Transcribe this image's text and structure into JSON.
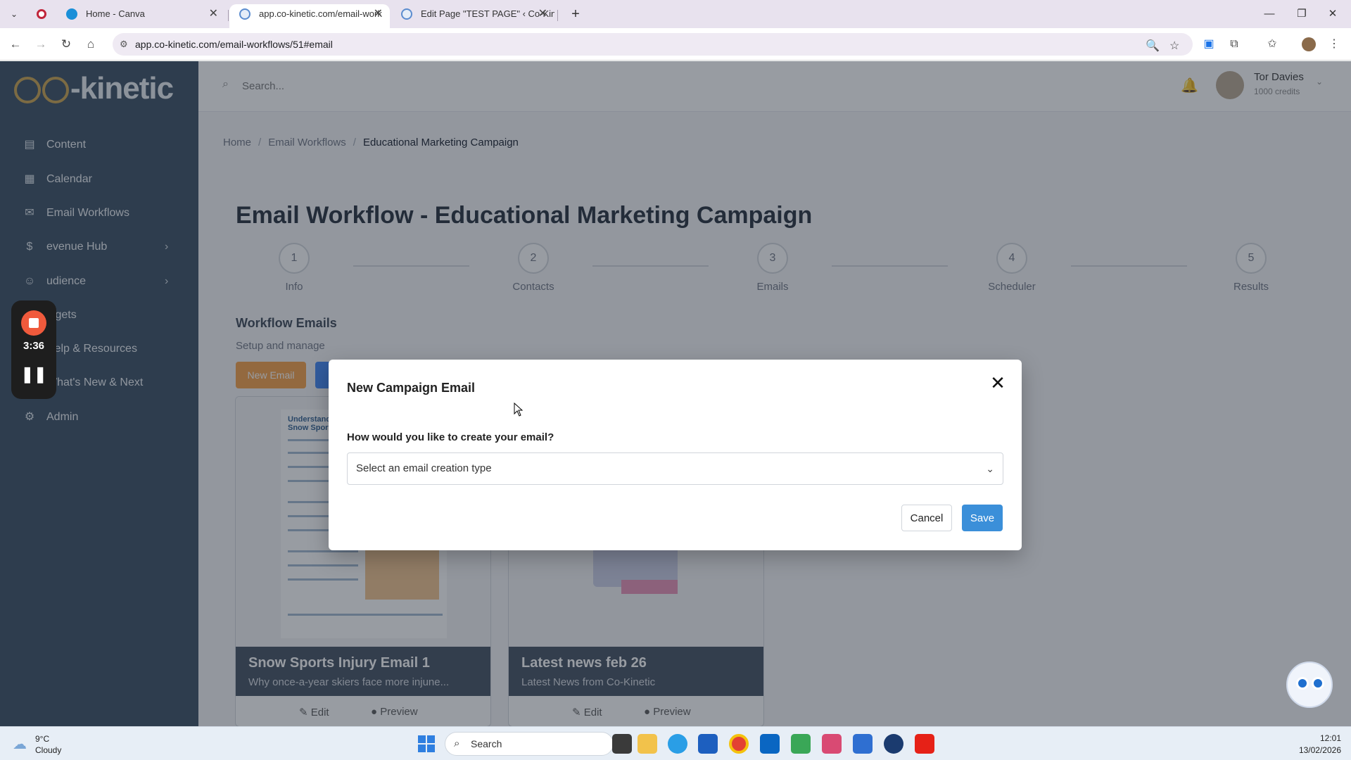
{
  "browser": {
    "tabs": [
      {
        "title": "Home - Canva",
        "active": false
      },
      {
        "title": "app.co-kinetic.com/email-work",
        "active": true
      },
      {
        "title": "Edit Page \"TEST PAGE\" ‹ Co-Kin",
        "active": false
      }
    ],
    "url": "app.co-kinetic.com/email-workflows/51#email"
  },
  "app": {
    "logo_text": "-kinetic",
    "sidebar": {
      "items": [
        {
          "label": "Content",
          "icon": "document-icon"
        },
        {
          "label": "Calendar",
          "icon": "calendar-icon"
        },
        {
          "label": "Email Workflows",
          "icon": "mail-icon"
        },
        {
          "label": "evenue Hub",
          "icon": "revenue-icon"
        },
        {
          "label": "udience",
          "icon": "audience-icon"
        },
        {
          "label": "idgets",
          "icon": "widgets-icon"
        },
        {
          "label": "Help & Resources",
          "icon": "help-icon"
        },
        {
          "label": "What's New & Next",
          "icon": "sparkle-icon"
        },
        {
          "label": "Admin",
          "icon": "gear-icon"
        }
      ]
    },
    "topbar": {
      "search_placeholder": "Search...",
      "user_name": "Tor Davies",
      "user_credits": "1000 credits"
    },
    "breadcrumb": [
      "Home",
      "Email Workflows",
      "Educational Marketing Campaign"
    ],
    "page_title": "Email Workflow - Educational Marketing Campaign",
    "steps": [
      {
        "number": "1",
        "label": "Info"
      },
      {
        "number": "2",
        "label": "Contacts"
      },
      {
        "number": "3",
        "label": "Emails"
      },
      {
        "number": "4",
        "label": "Scheduler"
      },
      {
        "number": "5",
        "label": "Results"
      }
    ],
    "section": {
      "title": "Workflow Emails",
      "subtitle": "Setup and manage",
      "new_email_label": "New Email"
    },
    "cards": [
      {
        "title": "Snow Sports Injury Email 1",
        "subtitle": "Why once-a-year skiers face more injune...",
        "edit": "Edit",
        "preview": "Preview",
        "thumb_text": "Understand Snow Sport"
      },
      {
        "title": "Latest news feb 26",
        "subtitle": "Latest News from Co-Kinetic",
        "edit": "Edit",
        "preview": "Preview"
      }
    ]
  },
  "recorder": {
    "time": "3:36"
  },
  "modal": {
    "title": "New Campaign Email",
    "question": "How would you like to create your email?",
    "select_value": "Select an email creation type",
    "cancel_label": "Cancel",
    "save_label": "Save"
  },
  "taskbar": {
    "weather_temp": "9°C",
    "weather_desc": "Cloudy",
    "search_label": "Search",
    "time": "12:01",
    "date": "13/02/2026"
  }
}
